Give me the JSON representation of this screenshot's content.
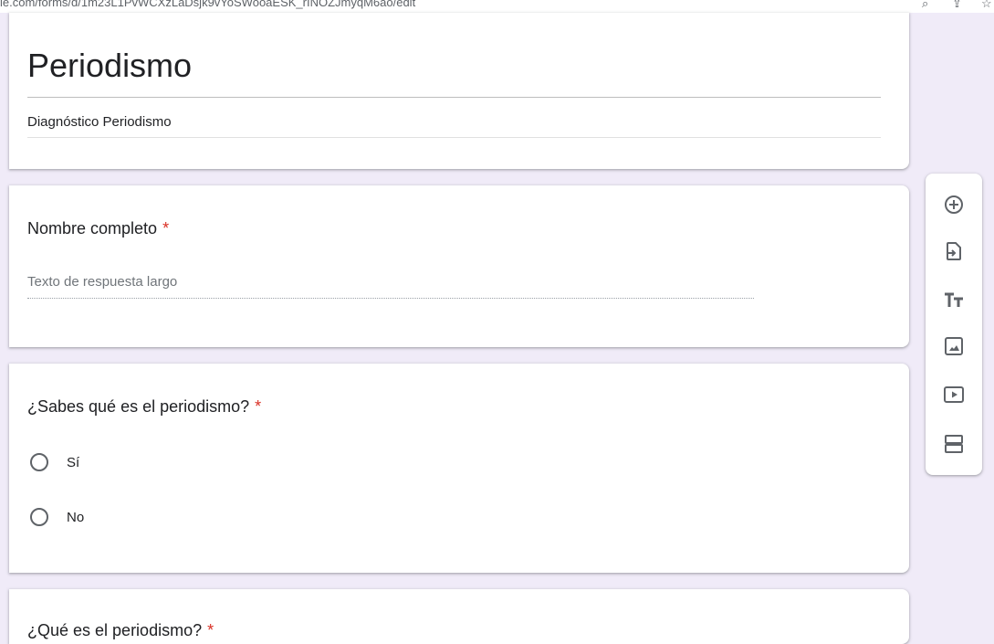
{
  "browser": {
    "url": "le.com/forms/d/1m23L1PvWCXzLaDsjk9vYoSWooaESK_rINOZJmyqM6ao/edit"
  },
  "form": {
    "title": "Periodismo",
    "description": "Diagnóstico Periodismo"
  },
  "questions": [
    {
      "title": "Nombre completo",
      "required_mark": "*",
      "answer_placeholder": "Texto de respuesta largo"
    },
    {
      "title": "¿Sabes qué es el periodismo?",
      "required_mark": "*",
      "options": [
        "Sí",
        "No"
      ]
    },
    {
      "title": "¿Qué es el periodismo?",
      "required_mark": "*"
    }
  ],
  "toolbar": {
    "icons": [
      "add-question-icon",
      "import-questions-icon",
      "add-title-icon",
      "add-image-icon",
      "add-video-icon",
      "add-section-icon"
    ]
  },
  "colors": {
    "background": "#f0ebf8",
    "required": "#d93025",
    "icon": "#5f6368"
  }
}
